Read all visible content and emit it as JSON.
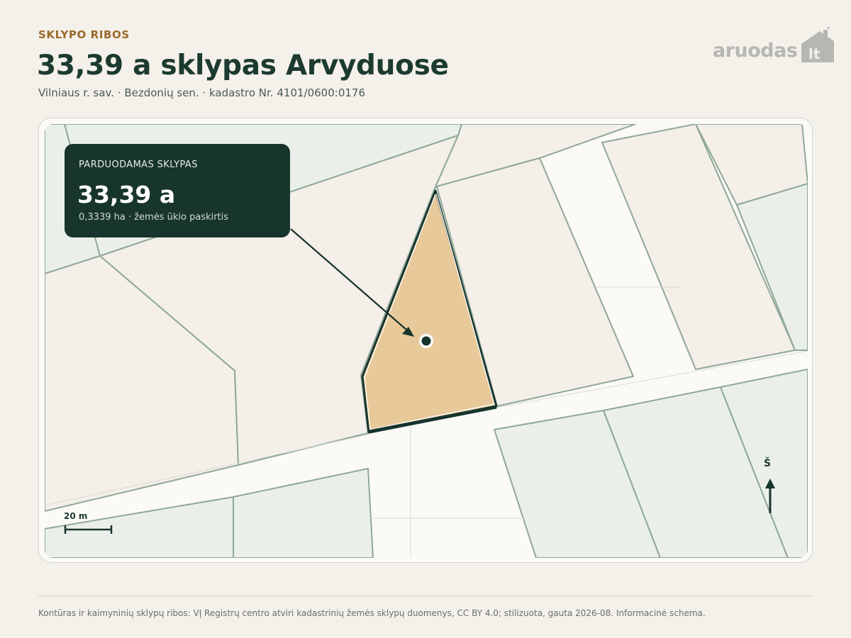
{
  "header": {
    "eyebrow": "SKLYPO RIBOS",
    "title": "33,39 a sklypas Arvyduose",
    "subtitle": "Vilniaus r. sav. · Bezdonių sen. · kadastro Nr. 4101/0600:0176"
  },
  "brand": {
    "logo_text": "aruodas",
    "logo_suffix": "lt",
    "logo_color": "#b7b7b2"
  },
  "callout": {
    "label": "PARDUODAMAS SKLYPAS",
    "value": "33,39 a",
    "detail": "0,3339 ha · žemės ūkio paskirtis"
  },
  "map": {
    "scale_label": "20 m",
    "north_label": "Š",
    "colors": {
      "parcel_fill": "#e8c99a",
      "parcel_outline": "#17342d",
      "green_parcel": "#eaf0e9",
      "beige_parcel": "#f4efe8",
      "road": "#fbfaf6",
      "boundary": "#8fa898"
    }
  },
  "footer": {
    "text": "Kontūras ir kaimyninių sklypų ribos: VĮ Registrų centro atviri kadastrinių žemės sklypų duomenys, CC BY 4.0; stilizuota, gauta 2026-08. Informacinė schema."
  }
}
